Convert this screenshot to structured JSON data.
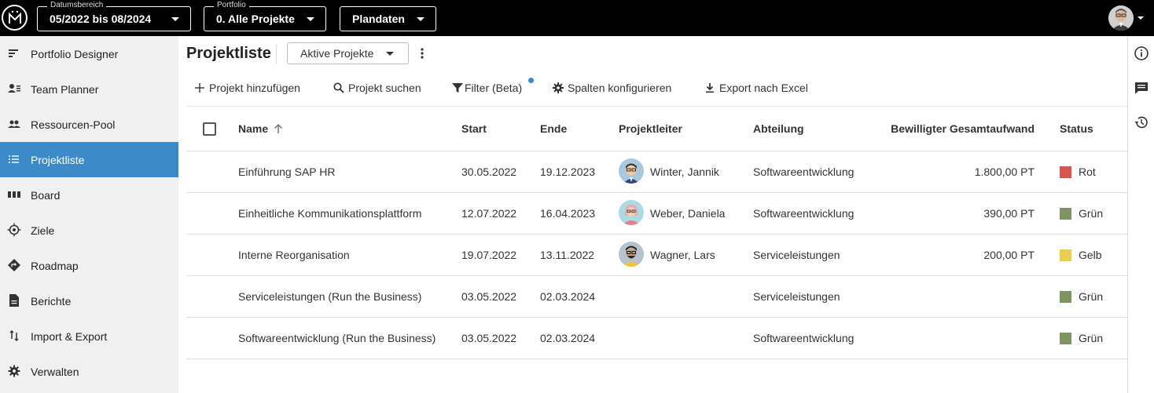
{
  "topbar": {
    "date_range": {
      "label": "Datumsbereich",
      "value": "05/2022 bis 08/2024"
    },
    "portfolio": {
      "label": "Portfolio",
      "value": "0. Alle Projekte"
    },
    "plandaten": {
      "value": "Plandaten"
    }
  },
  "sidebar": {
    "items": [
      {
        "label": "Portfolio Designer",
        "icon": "portfolio-designer-icon"
      },
      {
        "label": "Team Planner",
        "icon": "team-planner-icon"
      },
      {
        "label": "Ressourcen-Pool",
        "icon": "people-icon"
      },
      {
        "label": "Projektliste",
        "icon": "list-icon",
        "active": true
      },
      {
        "label": "Board",
        "icon": "board-icon"
      },
      {
        "label": "Ziele",
        "icon": "target-icon"
      },
      {
        "label": "Roadmap",
        "icon": "roadmap-icon"
      },
      {
        "label": "Berichte",
        "icon": "report-icon"
      },
      {
        "label": "Import & Export",
        "icon": "import-export-icon"
      },
      {
        "label": "Verwalten",
        "icon": "gear-icon"
      }
    ]
  },
  "main": {
    "title": "Projektliste",
    "view_select": "Aktive Projekte",
    "toolbar": {
      "add": "Projekt hinzufügen",
      "search": "Projekt suchen",
      "filter": "Filter (Beta)",
      "columns": "Spalten konfigurieren",
      "export": "Export nach Excel"
    },
    "table": {
      "headers": {
        "name": "Name",
        "start": "Start",
        "end": "Ende",
        "lead": "Projektleiter",
        "dept": "Abteilung",
        "effort": "Bewilligter Gesamtaufwand",
        "status": "Status"
      },
      "rows": [
        {
          "name": "Einführung SAP HR",
          "start": "30.05.2022",
          "end": "19.12.2023",
          "lead": "Winter, Jannik",
          "dept": "Softwareentwicklung",
          "effort": "1.800,00 PT",
          "status": "Rot",
          "status_color": "#d9534f"
        },
        {
          "name": "Einheitliche Kommunikationsplattform",
          "start": "12.07.2022",
          "end": "16.04.2023",
          "lead": "Weber, Daniela",
          "dept": "Softwareentwicklung",
          "effort": "390,00 PT",
          "status": "Grün",
          "status_color": "#7d9463"
        },
        {
          "name": "Interne Reorganisation",
          "start": "19.07.2022",
          "end": "13.11.2022",
          "lead": "Wagner, Lars",
          "dept": "Serviceleistungen",
          "effort": "200,00 PT",
          "status": "Gelb",
          "status_color": "#e8cf4f"
        },
        {
          "name": "Serviceleistungen (Run the Business)",
          "start": "03.05.2022",
          "end": "02.03.2024",
          "lead": "",
          "dept": "Serviceleistungen",
          "effort": "",
          "status": "Grün",
          "status_color": "#7d9463"
        },
        {
          "name": "Softwareentwicklung (Run the Business)",
          "start": "03.05.2022",
          "end": "02.03.2024",
          "lead": "",
          "dept": "Softwareentwicklung",
          "effort": "",
          "status": "Grün",
          "status_color": "#7d9463"
        }
      ]
    }
  }
}
